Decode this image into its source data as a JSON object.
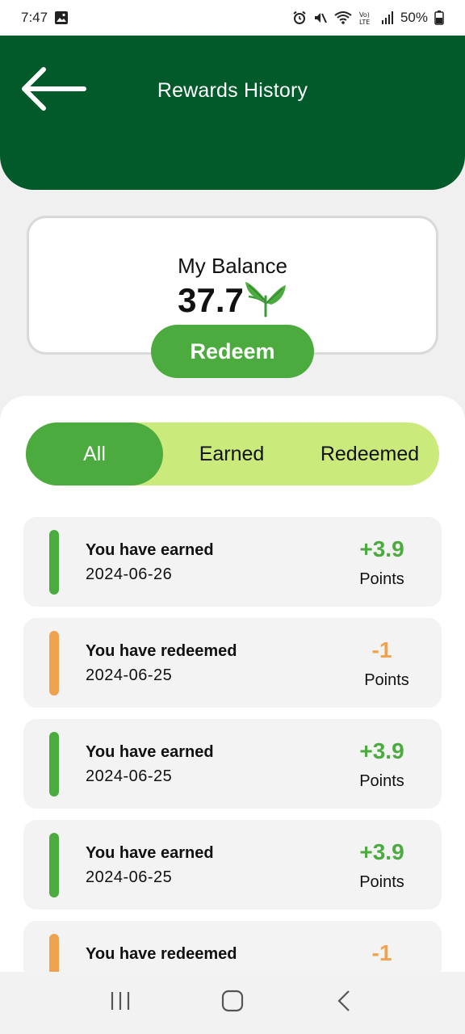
{
  "status_bar": {
    "time": "7:47",
    "battery": "50%",
    "icons": [
      "gallery-icon",
      "alarm-icon",
      "mute-icon",
      "wifi-icon",
      "volte-icon",
      "signal-icon",
      "battery-icon"
    ]
  },
  "header": {
    "title": "Rewards History",
    "back_icon": "arrow-left-icon",
    "color": "#025a2b"
  },
  "balance": {
    "label": "My Balance",
    "value": "37.7",
    "icon": "sprout-icon",
    "redeem_label": "Redeem"
  },
  "tabs": [
    {
      "label": "All",
      "active": true
    },
    {
      "label": "Earned",
      "active": false
    },
    {
      "label": "Redeemed",
      "active": false
    }
  ],
  "history": [
    {
      "title": "You have earned",
      "date": "2024-06-26",
      "amount": "+3.9",
      "unit": "Points",
      "type": "earned"
    },
    {
      "title": "You have redeemed",
      "date": "2024-06-25",
      "amount": "-1",
      "unit": "Points",
      "type": "redeemed"
    },
    {
      "title": "You have earned",
      "date": "2024-06-25",
      "amount": "+3.9",
      "unit": "Points",
      "type": "earned"
    },
    {
      "title": "You have earned",
      "date": "2024-06-25",
      "amount": "+3.9",
      "unit": "Points",
      "type": "earned"
    },
    {
      "title": "You have redeemed",
      "date": "",
      "amount": "-1",
      "unit": "",
      "type": "redeemed"
    }
  ],
  "colors": {
    "earned": "#4cab3e",
    "redeemed": "#efa34f",
    "tab_bg": "#cbea7c"
  },
  "nav_bar": {
    "icons": [
      "recent-apps-icon",
      "home-icon",
      "back-icon"
    ]
  }
}
